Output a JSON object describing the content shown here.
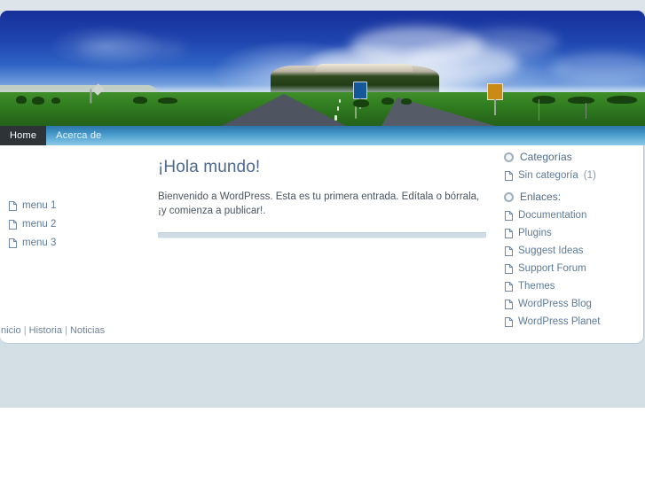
{
  "site": {
    "header_image_alt": "highway-landscape-header"
  },
  "nav": {
    "tabs": [
      {
        "label": "Home",
        "active": true
      },
      {
        "label": "Acerca de",
        "active": false
      }
    ]
  },
  "left_sidebar": {
    "items": [
      {
        "label": "menu 1",
        "icon": "page-icon"
      },
      {
        "label": "menu 2",
        "icon": "page-icon"
      },
      {
        "label": "menu 3",
        "icon": "page-icon"
      }
    ]
  },
  "post": {
    "title": "¡Hola mundo!",
    "body": "Bienvenido a WordPress. Esta es tu primera entrada. Edítala o bórrala, ¡y comienza a publicar!."
  },
  "right_sidebar": {
    "widgets": [
      {
        "title": "Categorías",
        "title_icon": "ring-icon",
        "items": [
          {
            "label": "Sin categoría",
            "count": "(1)",
            "icon": "page-icon"
          }
        ]
      },
      {
        "title": "Enlaces:",
        "title_icon": "ring-icon",
        "items": [
          {
            "label": "Documentation",
            "count": "",
            "icon": "page-icon"
          },
          {
            "label": "Plugins",
            "count": "",
            "icon": "page-icon"
          },
          {
            "label": "Suggest Ideas",
            "count": "",
            "icon": "page-icon"
          },
          {
            "label": "Support Forum",
            "count": "",
            "icon": "page-icon"
          },
          {
            "label": "Themes",
            "count": "",
            "icon": "page-icon"
          },
          {
            "label": "WordPress Blog",
            "count": "",
            "icon": "page-icon"
          },
          {
            "label": "WordPress Planet",
            "count": "",
            "icon": "page-icon"
          }
        ]
      }
    ]
  },
  "footer": {
    "links": [
      "Inicio",
      "Historia",
      "Noticias"
    ],
    "separator": "|"
  },
  "colors": {
    "nav_active_bg": "#2e3338",
    "nav_gradient_top": "#2c74a8",
    "nav_gradient_bottom": "#8cc8e6",
    "link_blue": "#5d7a99",
    "title_blue": "#4d6a8d",
    "body_band": "#d3dee5",
    "divider": "#cfdce6"
  }
}
